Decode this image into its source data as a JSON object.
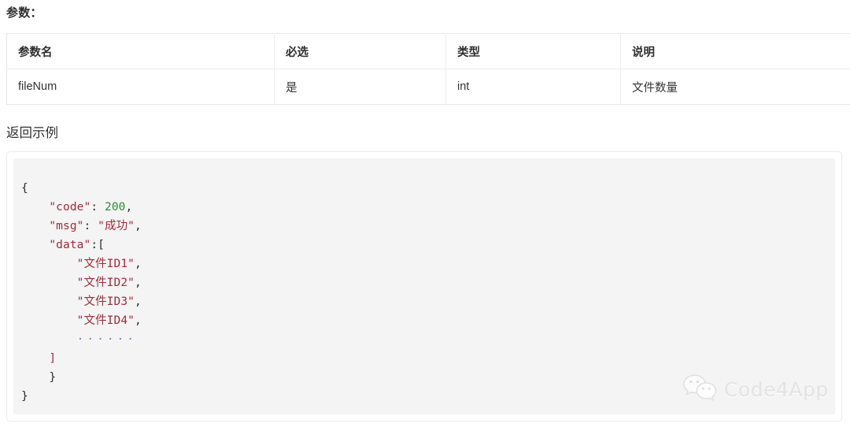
{
  "sections": {
    "params_heading": "参数：",
    "response_heading": "返回示例"
  },
  "param_table": {
    "columns": [
      "参数名",
      "必选",
      "类型",
      "说明"
    ],
    "rows": [
      {
        "name": "fileNum",
        "required": "是",
        "type": "int",
        "description": "文件数量"
      }
    ]
  },
  "code_block": {
    "language": "json",
    "lines": [
      {
        "indent": 0,
        "tokens": [
          {
            "t": "punc",
            "v": "{"
          }
        ]
      },
      {
        "indent": 1,
        "tokens": [
          {
            "t": "key",
            "v": "\"code\""
          },
          {
            "t": "punc",
            "v": ": "
          },
          {
            "t": "num",
            "v": "200"
          },
          {
            "t": "punc",
            "v": ","
          }
        ]
      },
      {
        "indent": 1,
        "tokens": [
          {
            "t": "key",
            "v": "\"msg\""
          },
          {
            "t": "punc",
            "v": ": "
          },
          {
            "t": "str",
            "v": "\"成功\""
          },
          {
            "t": "punc",
            "v": ","
          }
        ]
      },
      {
        "indent": 1,
        "tokens": [
          {
            "t": "key",
            "v": "\"data\""
          },
          {
            "t": "punc",
            "v": ":"
          },
          {
            "t": "punc",
            "v": "["
          }
        ]
      },
      {
        "indent": 2,
        "tokens": [
          {
            "t": "str",
            "v": "\"文件ID1\""
          },
          {
            "t": "punc",
            "v": ","
          }
        ]
      },
      {
        "indent": 2,
        "tokens": [
          {
            "t": "str",
            "v": "\"文件ID2\""
          },
          {
            "t": "punc",
            "v": ","
          }
        ]
      },
      {
        "indent": 2,
        "tokens": [
          {
            "t": "str",
            "v": "\"文件ID3\""
          },
          {
            "t": "punc",
            "v": ","
          }
        ]
      },
      {
        "indent": 2,
        "tokens": [
          {
            "t": "str",
            "v": "\"文件ID4\""
          },
          {
            "t": "punc",
            "v": ","
          }
        ]
      },
      {
        "indent": 2,
        "tokens": [
          {
            "t": "dots",
            "v": "······"
          }
        ]
      },
      {
        "indent": 1,
        "tokens": [
          {
            "t": "str",
            "v": "]"
          }
        ]
      },
      {
        "indent": 1,
        "tokens": [
          {
            "t": "punc",
            "v": "}"
          }
        ]
      },
      {
        "indent": 0,
        "tokens": [
          {
            "t": "punc",
            "v": "}"
          }
        ]
      }
    ]
  },
  "watermark": {
    "icon": "wechat-logo-icon",
    "text": "Code4App",
    "color": "#e3e3e3"
  },
  "colors": {
    "text": "#333333",
    "border": "#ececec",
    "code_bg": "#f4f4f4",
    "string": "#a02c3a",
    "number": "#2f8b36",
    "ellipsis": "#7b7bc0"
  }
}
